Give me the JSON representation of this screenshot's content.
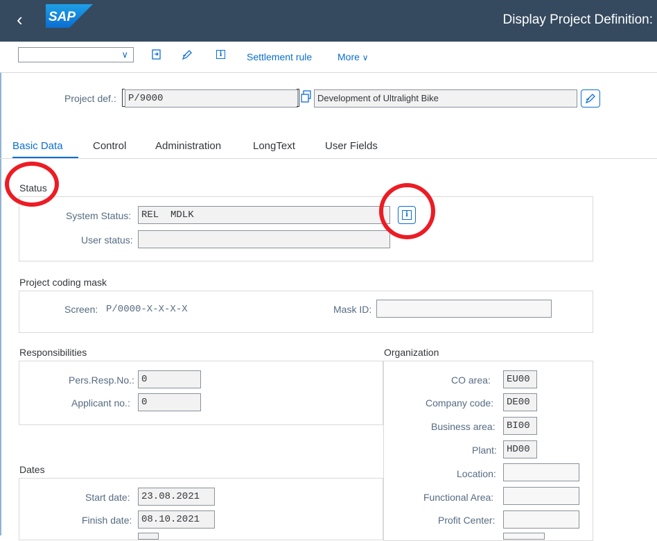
{
  "shell": {
    "logo_text": "SAP",
    "title": "Display Project Definition:",
    "back_icon": "chevron-left-icon"
  },
  "toolbar": {
    "dropdown_value": "",
    "icons": [
      "go-to-icon",
      "change-icon",
      "info-icon"
    ],
    "info_glyph": "i",
    "settlement_rule": "Settlement rule",
    "more": "More"
  },
  "header": {
    "project_def_label": "Project def.:",
    "project_def_value": "P/9000",
    "description": "Development of Ultralight Bike"
  },
  "tabs": [
    {
      "label": "Basic Data",
      "active": true
    },
    {
      "label": "Control",
      "active": false
    },
    {
      "label": "Administration",
      "active": false
    },
    {
      "label": "LongText",
      "active": false
    },
    {
      "label": "User Fields",
      "active": false
    }
  ],
  "status": {
    "title": "Status",
    "system_status_label": "System Status:",
    "system_status_value": "REL  MDLK",
    "user_status_label": "User status:",
    "user_status_value": "",
    "info_glyph": "i"
  },
  "coding_mask": {
    "title": "Project coding mask",
    "screen_label": "Screen:",
    "screen_value": "P/0000-X-X-X-X",
    "mask_id_label": "Mask ID:",
    "mask_id_value": ""
  },
  "responsibilities": {
    "title": "Responsibilities",
    "pers_resp_label": "Pers.Resp.No.:",
    "pers_resp_value": "0",
    "applicant_label": "Applicant no.:",
    "applicant_value": "0"
  },
  "organization": {
    "title": "Organization",
    "co_area_label": "CO area:",
    "co_area_value": "EU00",
    "company_code_label": "Company code:",
    "company_code_value": "DE00",
    "business_area_label": "Business area:",
    "business_area_value": "BI00",
    "plant_label": "Plant:",
    "plant_value": "HD00",
    "location_label": "Location:",
    "location_value": "",
    "functional_area_label": "Functional Area:",
    "functional_area_value": "",
    "profit_center_label": "Profit Center:",
    "profit_center_value": ""
  },
  "dates": {
    "title": "Dates",
    "start_label": "Start date:",
    "start_value": "23.08.2021",
    "finish_label": "Finish date:",
    "finish_value": "08.10.2021"
  },
  "colors": {
    "shell": "#354a5f",
    "accent": "#0a6ed1",
    "highlight_circle": "#ec1c24"
  }
}
